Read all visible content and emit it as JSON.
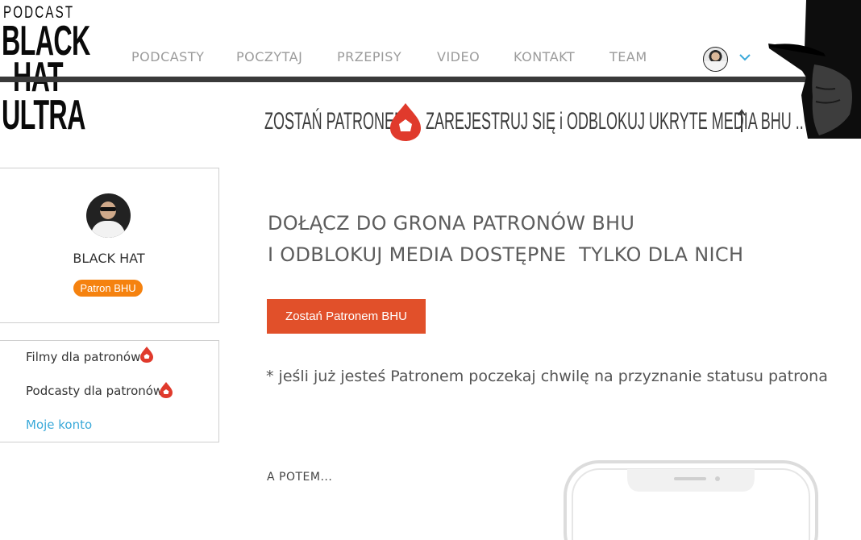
{
  "logo": {
    "line1": "PODCAST",
    "line2": "BLACK",
    "line3": "HAT",
    "line4": "ULTRA"
  },
  "nav": {
    "items": [
      "PODCASTY",
      "POCZYTAJ",
      "PRZEPISY",
      "VIDEO",
      "KONTAKT",
      "TEAM"
    ]
  },
  "banner": {
    "left_text": "ZOSTAŃ PATRONEM",
    "right_text": "ZAREJESTRUJ SIĘ i ODBLOKUJ UKRYTE MEDIA BHU .."
  },
  "profile": {
    "name": "BLACK HAT",
    "badge": "Patron BHU"
  },
  "menu": {
    "films": "Filmy dla patronów",
    "podcasts": "Podcasty dla patronów",
    "account": "Moje konto"
  },
  "main": {
    "headline_line1": "DOŁĄCZ DO GRONA PATRONÓW BHU",
    "headline_line2": "I ODBLOKUJ MEDIA DOSTĘPNE  TYLKO DLA NICH",
    "cta_label": "Zostań Patronem BHU",
    "note": "* jeśli już jesteś Patronem poczekaj chwilę na przyznanie statusu patrona",
    "next_label": "A POTEM..."
  },
  "colors": {
    "accent": "#e1502a",
    "badge": "#f5820f",
    "link": "#3aa9d9",
    "nav_text": "#9b9b9b",
    "drop_red": "#e03a2c"
  },
  "icons": {
    "drop": "patron-drop-icon",
    "chevron": "chevron-down-icon",
    "hat": "black-hat-figure"
  }
}
